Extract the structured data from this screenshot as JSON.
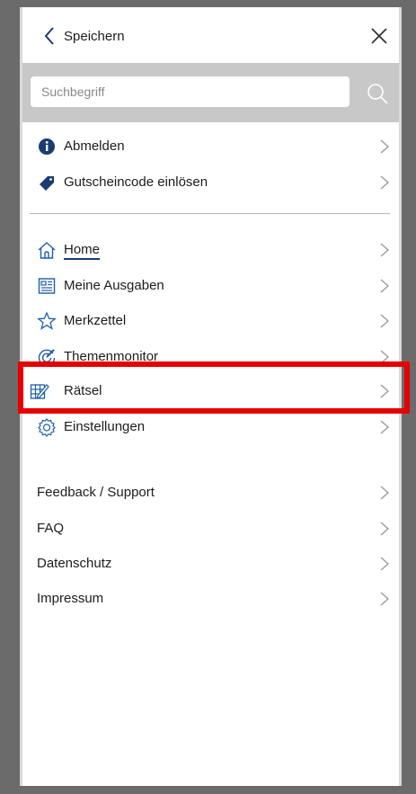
{
  "header": {
    "back_label": "Speichern"
  },
  "search": {
    "placeholder": "Suchbegriff"
  },
  "account_items": [
    {
      "label": "Abmelden",
      "icon": "info-icon"
    },
    {
      "label": "Gutscheincode einlösen",
      "icon": "tag-icon"
    }
  ],
  "nav_items": [
    {
      "label": "Home",
      "icon": "home-icon"
    },
    {
      "label": "Meine Ausgaben",
      "icon": "newspaper-icon"
    },
    {
      "label": "Merkzettel",
      "icon": "star-icon"
    },
    {
      "label": "Themenmonitor",
      "icon": "radar-icon"
    },
    {
      "label": "Rätsel",
      "icon": "puzzle-grid-icon"
    },
    {
      "label": "Einstellungen",
      "icon": "gear-icon"
    }
  ],
  "info_items": [
    {
      "label": "Feedback / Support"
    },
    {
      "label": "FAQ"
    },
    {
      "label": "Datenschutz"
    },
    {
      "label": "Impressum"
    }
  ],
  "colors": {
    "accent": "#1a3c72",
    "icon_blue": "#1f5fa8",
    "highlight": "#e60000",
    "search_bg": "#c8c8c8"
  }
}
